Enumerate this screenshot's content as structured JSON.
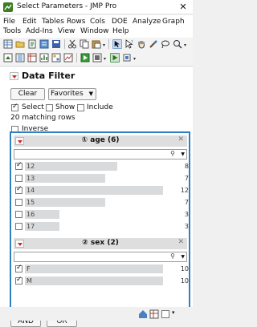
{
  "window": {
    "title": "Select Parameters - JMP Pro",
    "close_glyph": "✕"
  },
  "menu": [
    "File",
    "Edit",
    "Tables",
    "Rows",
    "Cols",
    "DOE",
    "Analyze",
    "Graph",
    "Tools",
    "Add-Ins",
    "View",
    "Window",
    "Help"
  ],
  "panel": {
    "expander_label": "Data Filter",
    "clear_label": "Clear",
    "favorites_label": "Favorites",
    "favorites_arrow": "▼",
    "select_label": "Select",
    "show_label": "Show",
    "include_label": "Include",
    "select_checked": true,
    "show_checked": false,
    "include_checked": false,
    "matching_text": "20 matching rows",
    "inverse_label": "Inverse",
    "inverse_checked": false
  },
  "filters": [
    {
      "title": "① age (6)",
      "close_glyph": "✕",
      "search_icon": "⚲",
      "dropdown_glyph": "▼",
      "items": [
        {
          "label": "12",
          "count": "8",
          "checked": true,
          "fraction": 0.667
        },
        {
          "label": "13",
          "count": "7",
          "checked": false,
          "fraction": 0.583
        },
        {
          "label": "14",
          "count": "12",
          "checked": true,
          "fraction": 1.0
        },
        {
          "label": "15",
          "count": "7",
          "checked": false,
          "fraction": 0.583
        },
        {
          "label": "16",
          "count": "3",
          "checked": false,
          "fraction": 0.25
        },
        {
          "label": "17",
          "count": "3",
          "checked": false,
          "fraction": 0.25
        }
      ]
    },
    {
      "title": "② sex (2)",
      "close_glyph": "✕",
      "search_icon": "⚲",
      "dropdown_glyph": "▼",
      "items": [
        {
          "label": "F",
          "count": "10",
          "checked": true,
          "fraction": 1.0
        },
        {
          "label": "M",
          "count": "10",
          "checked": true,
          "fraction": 1.0
        }
      ]
    }
  ],
  "buttons": {
    "and_label": "AND",
    "or_label": "OR"
  },
  "colors": {
    "accent": "#2e7fc6",
    "red_triangle": "#d4262a",
    "bar": "#d9dadc",
    "header": "#dedede"
  }
}
